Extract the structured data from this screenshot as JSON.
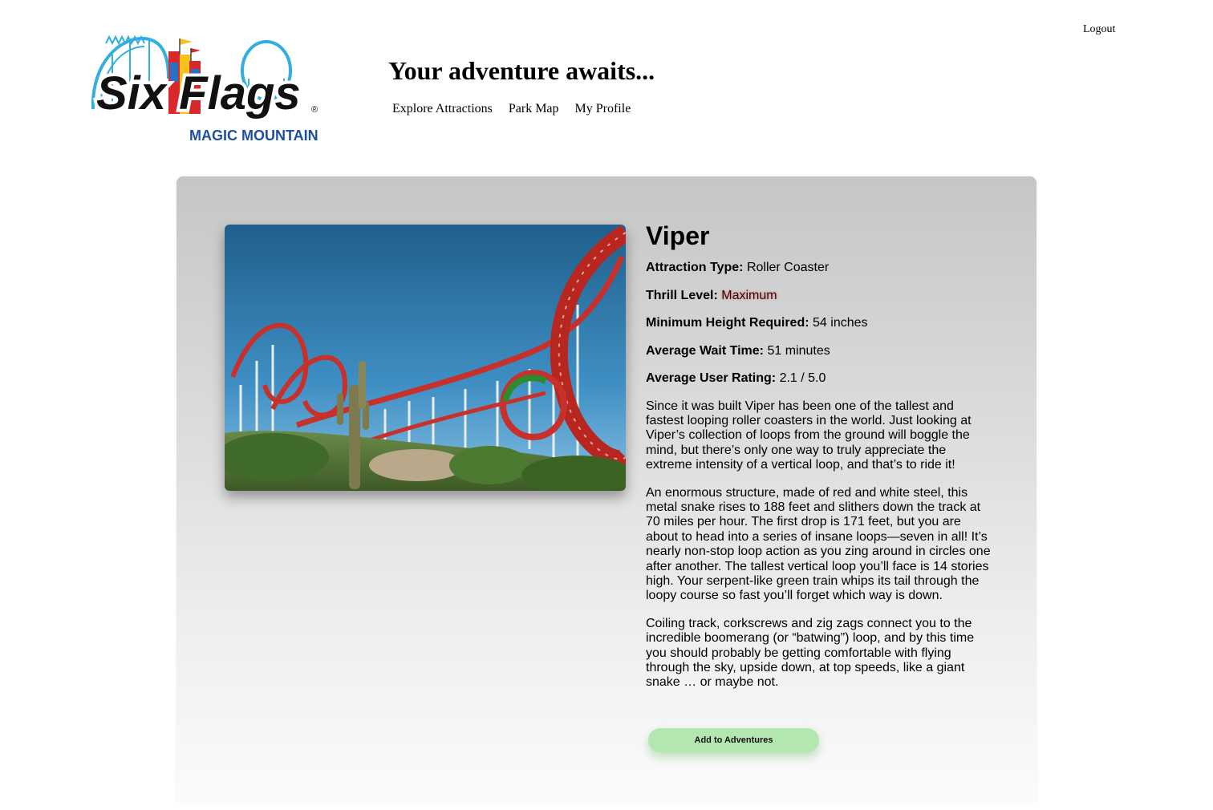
{
  "header": {
    "logout_label": "Logout",
    "logo": {
      "brand": "Six Flags",
      "park": "MAGIC MOUNTAIN",
      "mark": "®"
    },
    "tagline": "Your adventure awaits...",
    "nav": [
      {
        "label": "Explore Attractions"
      },
      {
        "label": "Park Map"
      },
      {
        "label": "My Profile"
      }
    ]
  },
  "attraction": {
    "name": "Viper",
    "image_icon": "roller-coaster-photo",
    "facts": {
      "type_label": "Attraction Type:",
      "type_value": "Roller Coaster",
      "thrill_label": "Thrill Level:",
      "thrill_value": "Maximum",
      "height_label": "Minimum Height Required:",
      "height_value": "54 inches",
      "wait_label": "Average Wait Time:",
      "wait_value": "51 minutes",
      "rating_label": "Average User Rating:",
      "rating_value": "2.1 / 5.0"
    },
    "description": [
      "Since it was built Viper has been one of the tallest and fastest looping roller coasters in the world. Just looking at Viper’s collection of loops from the ground will boggle the mind, but there’s only one way to truly appreciate the extreme intensity of a vertical loop, and that’s to ride it!",
      "An enormous structure, made of red and white steel, this metal snake rises to 188 feet and slithers down the track at 70 miles per hour.  The first drop is 171 feet, but you are about to head into a series of insane loops—seven in all! It’s nearly non-stop loop action as you zing around in circles one after another. The tallest vertical loop you’ll face is 14 stories high. Your serpent-like green train whips its tail through the loopy course so fast you’ll forget which way is down.",
      "Coiling track, corkscrews and zig zags connect you to the incredible boomerang (or “batwing”) loop, and by this time you should probably be getting comfortable with flying through the sky, upside down, at top speeds, like a giant snake … or maybe not."
    ],
    "add_button_label": "Add to Adventures"
  },
  "colors": {
    "logo_blue": "#1d4fa3",
    "track_red": "#c8302b",
    "button_green": "#b3e7b0"
  }
}
